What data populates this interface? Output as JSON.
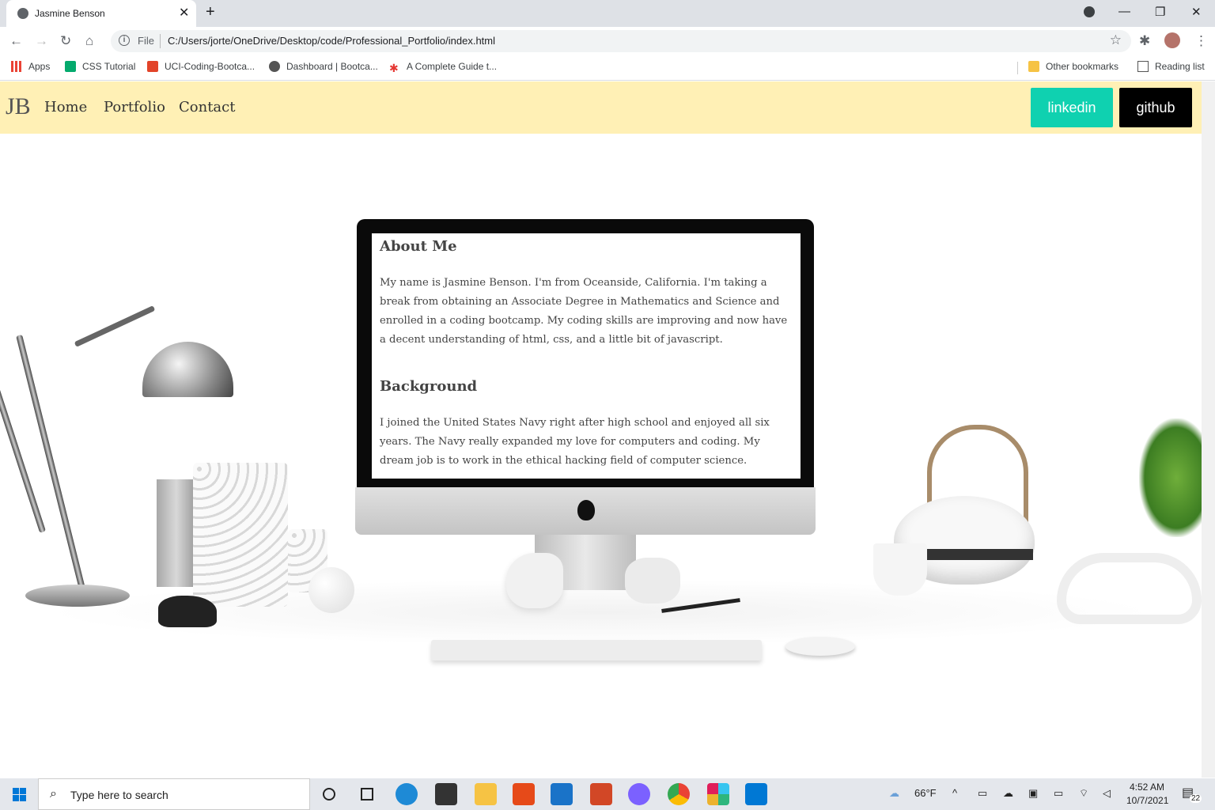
{
  "browser": {
    "tab_title": "Jasmine Benson",
    "tab_close": "✕",
    "new_tab": "+",
    "window_min": "—",
    "window_max": "❐",
    "window_close": "✕",
    "address_scheme": "File",
    "address_url": "C:/Users/jorte/OneDrive/Desktop/code/Professional_Portfolio/index.html",
    "bookmarks": [
      "Apps",
      "CSS Tutorial",
      "UCI-Coding-Bootca...",
      "Dashboard | Bootca...",
      "A Complete Guide t..."
    ],
    "other_bookmarks": "Other bookmarks",
    "reading_list": "Reading list"
  },
  "site": {
    "logo": "JB",
    "nav": [
      "Home",
      "Portfolio",
      "Contact"
    ],
    "linkedin": "linkedin",
    "github": "github",
    "colors": {
      "nav_bg": "#fff0b5",
      "linkedin": "#0fd1b0",
      "github": "#000000"
    }
  },
  "about": {
    "heading": "About Me",
    "text": "My name is Jasmine Benson. I'm from Oceanside, California. I'm taking a break from obtaining an Associate Degree in Mathematics and Science and enrolled in a coding bootcamp. My coding skills are improving and now have a decent understanding of html, css, and a little bit of javascript."
  },
  "background": {
    "heading": "Background",
    "text": "I joined the United States Navy right after high school and enjoyed all six years. The Navy really expanded my love for computers and coding. My dream job is to work in the ethical hacking field of computer science."
  },
  "taskbar": {
    "search_placeholder": "Type here to search",
    "weather": "66°F",
    "time": "4:52 AM",
    "date": "10/7/2021",
    "notifications": "22"
  }
}
